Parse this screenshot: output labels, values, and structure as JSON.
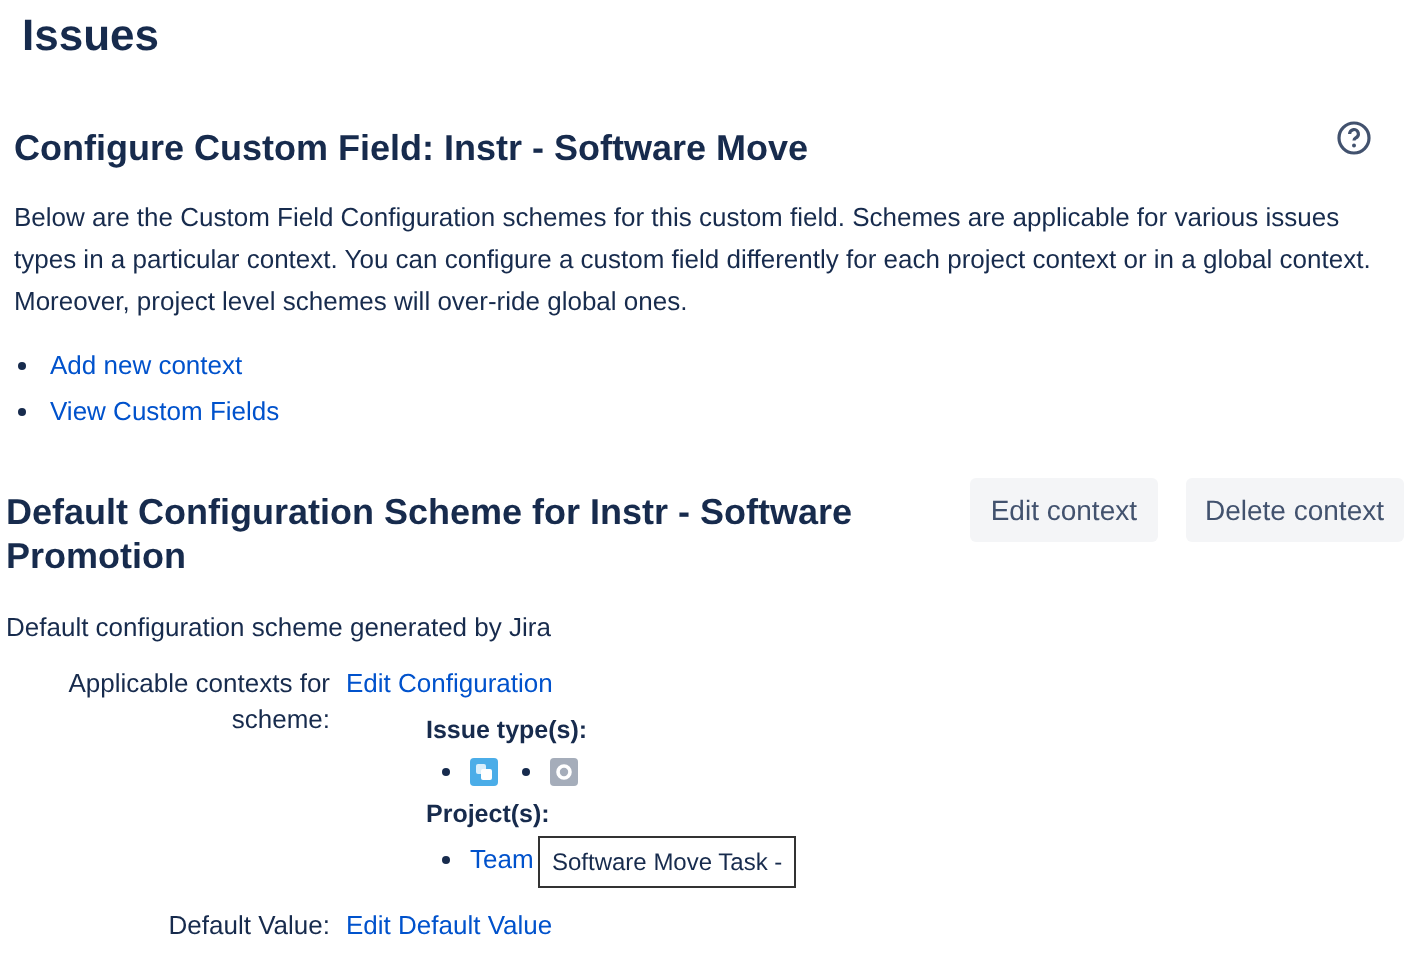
{
  "page_title": "Issues",
  "section": {
    "title": "Configure Custom Field: Instr - Software Move",
    "description": "Below are the Custom Field Configuration schemes for this custom field. Schemes are applicable for various issues types in a particular context. You can configure a custom field differently for each project context or in a global context. Moreover, project level schemes will over-ride global ones.",
    "links": [
      "Add new context",
      "View Custom Fields"
    ]
  },
  "scheme": {
    "title": "Default Configuration Scheme for Instr - Software Promotion",
    "buttons": [
      "Edit context",
      "Delete context"
    ],
    "description": "Default configuration scheme generated by Jira",
    "contexts_label": "Applicable contexts for scheme:",
    "contexts_link": "Edit Configuration",
    "issue_types_label": "Issue type(s):",
    "issue_types": [
      {
        "kind": "subtask",
        "color": "#4bade8"
      },
      {
        "kind": "other",
        "color": "#a5adba"
      }
    ],
    "projects_label": "Project(s):",
    "projects": [
      "Team"
    ],
    "default_label": "Default Value:",
    "default_link": "Edit Default Value"
  },
  "tooltip": "Software Move Task -"
}
